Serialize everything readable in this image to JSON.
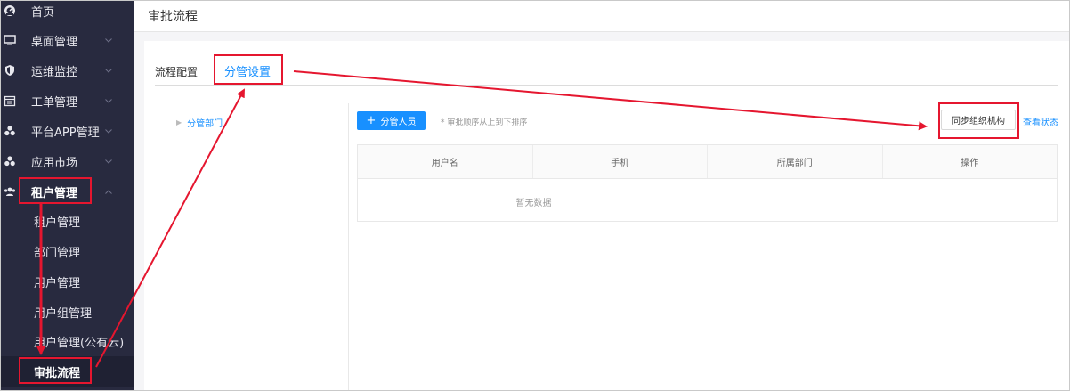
{
  "sidebar": {
    "items": [
      {
        "label": "首页",
        "icon": "dashboard-icon",
        "has_chevron": false
      },
      {
        "label": "桌面管理",
        "icon": "monitor-icon",
        "has_chevron": true
      },
      {
        "label": "运维监控",
        "icon": "shield-icon",
        "has_chevron": true
      },
      {
        "label": "工单管理",
        "icon": "calendar-icon",
        "has_chevron": true
      },
      {
        "label": "平台APP管理",
        "icon": "apps-icon",
        "has_chevron": true
      },
      {
        "label": "应用市场",
        "icon": "apps-icon",
        "has_chevron": true
      },
      {
        "label": "租户管理",
        "icon": "users-icon",
        "has_chevron": true,
        "expanded": true
      }
    ],
    "submenu": [
      {
        "label": "租户管理"
      },
      {
        "label": "部门管理"
      },
      {
        "label": "用户管理"
      },
      {
        "label": "用户组管理"
      },
      {
        "label": "用户管理(公有云)"
      },
      {
        "label": "审批流程",
        "active": true
      }
    ]
  },
  "header": {
    "title": "审批流程"
  },
  "tabs": [
    {
      "label": "流程配置"
    },
    {
      "label": "分管设置",
      "active": true
    }
  ],
  "tree": {
    "root_label": "分管部门"
  },
  "toolbar": {
    "add_label": "分管人员",
    "hint": "* 审批顺序从上到下排序",
    "sync_label": "同步组织机构",
    "status_link": "查看状态"
  },
  "table": {
    "columns": [
      "用户名",
      "手机",
      "所属部门",
      "操作"
    ],
    "empty_text": "暂无数据"
  },
  "colors": {
    "sidebar_bg": "#282a3f",
    "accent": "#1890ff",
    "annotation": "#e5162f"
  }
}
